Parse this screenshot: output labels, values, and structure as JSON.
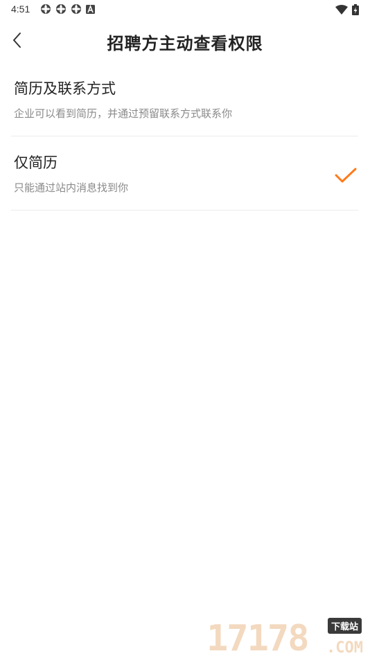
{
  "status_bar": {
    "time": "4:51",
    "left_icons": [
      "sync-icon",
      "sync-icon",
      "sync-icon",
      "a-icon"
    ],
    "right_icons": [
      "wifi-icon",
      "battery-charging-icon"
    ]
  },
  "header": {
    "title": "招聘方主动查看权限",
    "back_icon": "chevron-left-icon"
  },
  "options": [
    {
      "title": "简历及联系方式",
      "description": "企业可以看到简历，并通过预留联系方式联系你",
      "selected": false
    },
    {
      "title": "仅简历",
      "description": "只能通过站内消息找到你",
      "selected": true
    }
  ],
  "colors": {
    "accent": "#ff7a1a",
    "divider": "#ececec",
    "secondary_text": "#8a8a8a"
  },
  "watermark": {
    "digits": "17178",
    "badge": "下载站",
    "suffix": ".COM"
  }
}
